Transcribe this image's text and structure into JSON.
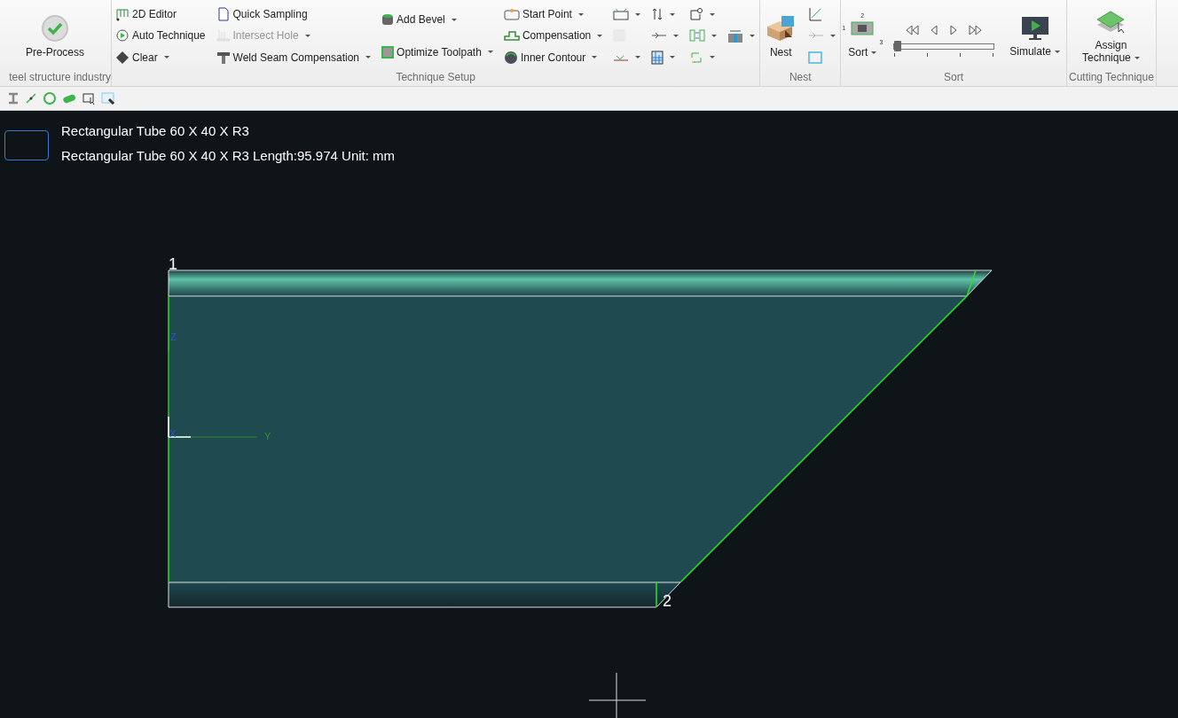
{
  "ribbon": {
    "groups": [
      {
        "label": "teel structure industry",
        "columns": [
          [
            {
              "kind": "large",
              "label": "Pre-Process",
              "dropdown": false,
              "disabled": false
            }
          ]
        ]
      },
      {
        "label": "Technique Setup",
        "columns": [
          [
            {
              "kind": "small",
              "label": "2D Editor",
              "dropdown": false,
              "disabled": false
            },
            {
              "kind": "small",
              "label": "Auto Technique",
              "dropdown": false,
              "disabled": false
            },
            {
              "kind": "small",
              "label": "Clear",
              "dropdown": true,
              "disabled": false
            }
          ],
          [
            {
              "kind": "small",
              "label": "Quick Sampling",
              "dropdown": false,
              "disabled": false
            },
            {
              "kind": "small",
              "label": "Intersect Hole",
              "dropdown": true,
              "disabled": true
            },
            {
              "kind": "small",
              "label": "Weld Seam Compensation",
              "dropdown": true,
              "disabled": false
            }
          ],
          [
            {
              "kind": "small",
              "label": "Add Bevel",
              "dropdown": true,
              "disabled": false
            },
            {
              "kind": "small",
              "label": "Optimize Toolpath",
              "dropdown": true,
              "disabled": false
            }
          ],
          [
            {
              "kind": "small",
              "label": "Start Point",
              "dropdown": true,
              "disabled": false
            },
            {
              "kind": "small",
              "label": "Compensation",
              "dropdown": true,
              "disabled": false
            },
            {
              "kind": "small",
              "label": "Inner Contour",
              "dropdown": true,
              "disabled": false
            }
          ],
          [
            {
              "kind": "icon",
              "dropdown": true,
              "disabled": false
            },
            {
              "kind": "icon",
              "dropdown": false,
              "disabled": true
            },
            {
              "kind": "icon",
              "dropdown": true,
              "disabled": false
            }
          ],
          [
            {
              "kind": "icon",
              "dropdown": true,
              "disabled": false
            },
            {
              "kind": "icon",
              "dropdown": true,
              "disabled": false
            },
            {
              "kind": "icon",
              "dropdown": true,
              "disabled": false
            }
          ],
          [
            {
              "kind": "icon",
              "dropdown": true,
              "disabled": false
            },
            {
              "kind": "icon",
              "dropdown": true,
              "disabled": false
            },
            {
              "kind": "icon",
              "dropdown": true,
              "disabled": false
            }
          ],
          [
            {
              "kind": "icon",
              "dropdown": true,
              "disabled": false
            }
          ]
        ]
      },
      {
        "label": "Nest",
        "columns": [
          [
            {
              "kind": "large",
              "label": "Nest",
              "dropdown": false,
              "disabled": false
            }
          ],
          [
            {
              "kind": "icon",
              "dropdown": false,
              "disabled": false
            },
            {
              "kind": "icon",
              "dropdown": true,
              "disabled": true
            },
            {
              "kind": "icon",
              "dropdown": false,
              "disabled": false
            }
          ]
        ]
      },
      {
        "label": "Sort",
        "columns": [
          [
            {
              "kind": "large",
              "label": "Sort",
              "dropdown": true,
              "disabled": false,
              "icon_digits": [
                "2",
                "1",
                "3"
              ]
            }
          ],
          [
            {
              "kind": "player",
              "level": 0
            }
          ],
          [
            {
              "kind": "large",
              "label": "Simulate",
              "dropdown": true,
              "disabled": false
            }
          ]
        ]
      },
      {
        "label": "Cutting Technique",
        "columns": [
          [
            {
              "kind": "large",
              "label": "Assign Technique",
              "dropdown": true,
              "disabled": false
            }
          ]
        ]
      }
    ]
  },
  "canvas": {
    "part_title": "Rectangular Tube 60 X 40 X R3",
    "part_detail": "Rectangular Tube 60 X 40 X R3 Length:95.974 Unit: mm",
    "vertex_labels": [
      "1",
      "2"
    ],
    "axis_labels": [
      "Z",
      "X",
      "Y"
    ]
  }
}
